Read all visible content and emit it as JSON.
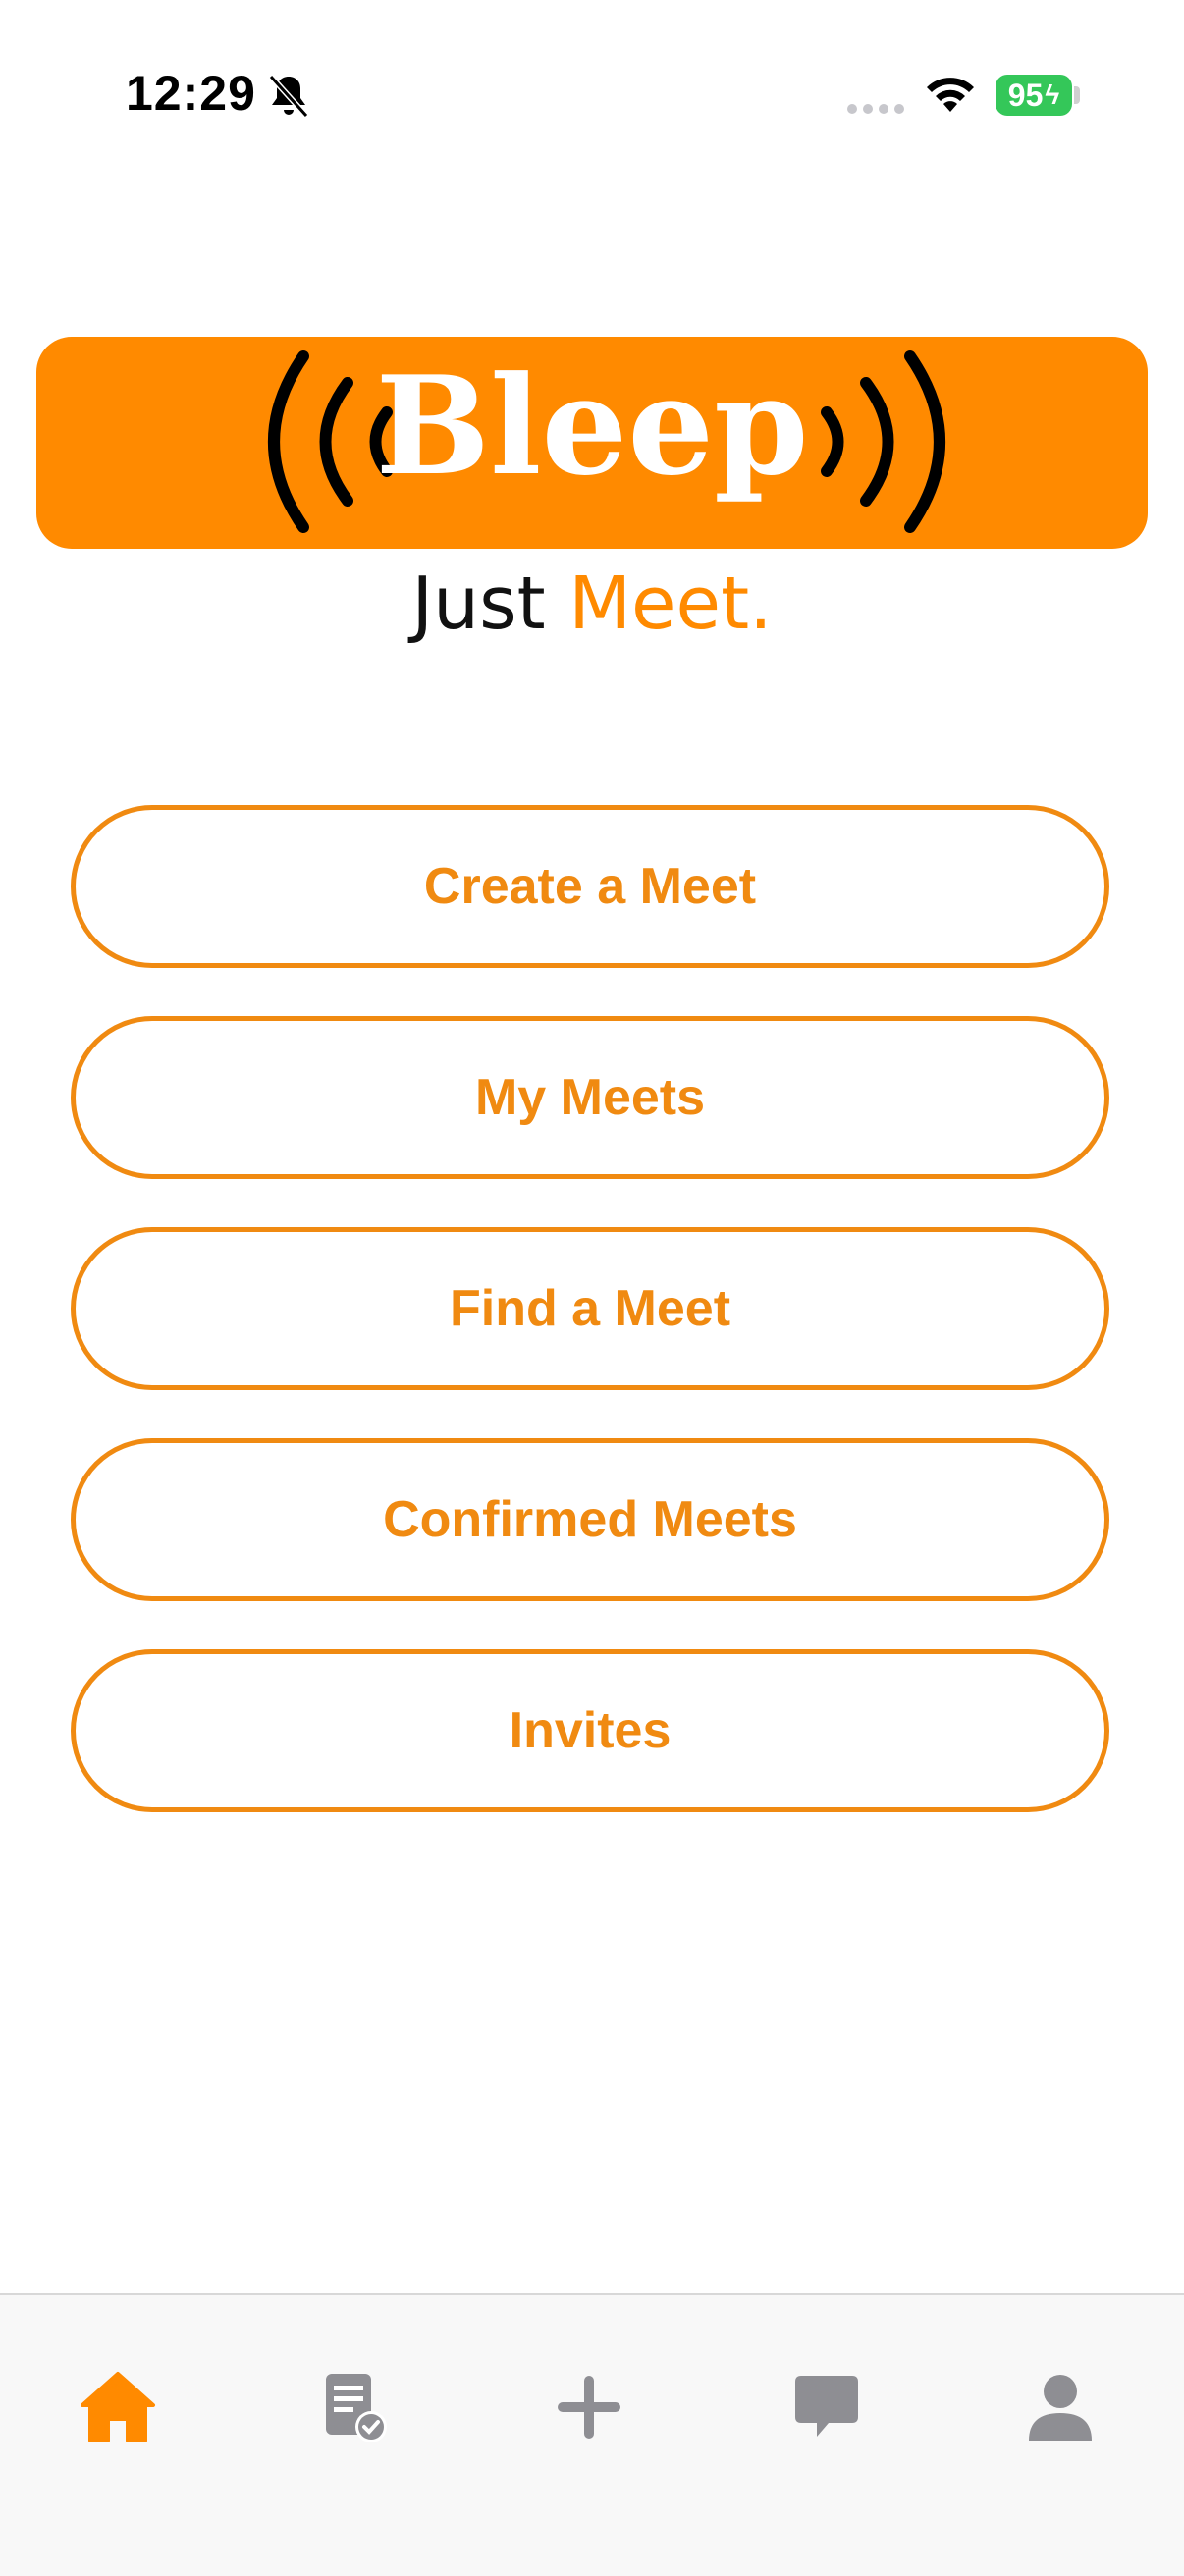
{
  "status_bar": {
    "time": "12:29",
    "battery": "95"
  },
  "logo": {
    "word": "Bleep"
  },
  "tagline": {
    "part1": "Just",
    "part2": "Meet."
  },
  "menu": {
    "create": "Create a Meet",
    "my_meets": "My Meets",
    "find": "Find a Meet",
    "confirmed": "Confirmed Meets",
    "invites": "Invites"
  },
  "tab_bar": {
    "icons": [
      "home-icon",
      "meets-list-icon",
      "plus-icon",
      "chat-icon",
      "profile-icon"
    ],
    "active": "home-icon"
  },
  "colors": {
    "accent": "#ff8a00",
    "inactive": "#8e8e93",
    "battery": "#34c759"
  }
}
